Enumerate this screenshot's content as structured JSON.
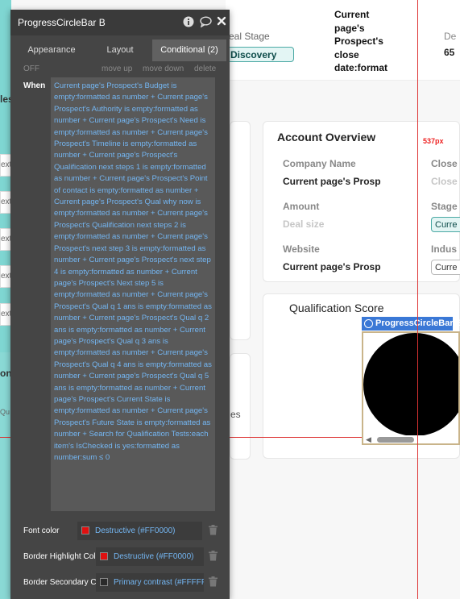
{
  "panel": {
    "title": "ProgressCircleBar B",
    "tabs": [
      "Appearance",
      "Layout",
      "Conditional (2)"
    ],
    "toggle": "OFF",
    "move_up": "move up",
    "move_down": "move down",
    "delete": "delete",
    "when_label": "When",
    "expression": "Current page's Prospect's Budget is empty:formatted as number + Current page's Prospect's Authority is empty:formatted as number + Current page's Prospect's Need is empty:formatted as number + Current page's Prospect's Timeline is empty:formatted as number + Current page's Prospect's Qualification next steps 1 is empty:formatted as number + Current page's Prospect's Point of contact is empty:formatted as number + Current page's Prospect's Qual why now is empty:formatted as number + Current page's Prospect's Qualification next steps 2 is empty:formatted as number + Current page's Prospect's next step 3 is empty:formatted as number + Current page's Prospect's next step 4 is empty:formatted as number + Current page's Prospect's Next step 5 is empty:formatted as number + Current page's Prospect's Qual q 1 ans is empty:formatted as number + Current page's Prospect's Qual q 2 ans is empty:formatted as number + Current page's Prospect's Qual q 3 ans is empty:formatted as number + Current page's Prospect's Qual q 4 ans is empty:formatted as number + Current page's Prospect's Qual q 5 ans is empty:formatted as number + Current page's Prospect's Current State is empty:formatted as number + Current page's Prospect's Future State is empty:formatted as number + Search for Qualification Tests:each item's IsChecked is yes:formatted as number:sum ≤ 0",
    "props": [
      {
        "label": "Font color",
        "value": "Destructive (#FF0000)",
        "swatch": "#e01010"
      },
      {
        "label": "Border Highlight Col",
        "value": "Destructive (#FF0000)",
        "swatch": "#e01010"
      },
      {
        "label": "Border Secondary C",
        "value": "Primary contrast (#FFFFF",
        "swatch": "#2a2a2a"
      }
    ]
  },
  "background": {
    "deal_stage_label": "eal Stage",
    "deal_stage_value": "Discovery",
    "close_date": "Current page's Prospect's close date:format",
    "de_label": "De",
    "de_value": "65",
    "left_fragment_1": "les",
    "left_fragment_2": "on",
    "left_fragment_3": "Qu",
    "ext_text": "ext",
    "mid_fragment": "es",
    "account": {
      "title": "Account Overview",
      "company_label": "Company Name",
      "company_value": "Current page's Prosp",
      "close_label": "Close",
      "close_value": "Close",
      "amount_label": "Amount",
      "amount_value": "Deal size",
      "stage_label": "Stage",
      "stage_value": "Curre",
      "website_label": "Website",
      "website_value": "Current page's Prosp",
      "industry_label": "Indus",
      "industry_value": "Curre"
    },
    "qualification_title": "Qualification Score",
    "element_tag": "ProgressCircleBar B",
    "guide_label": "537px"
  }
}
